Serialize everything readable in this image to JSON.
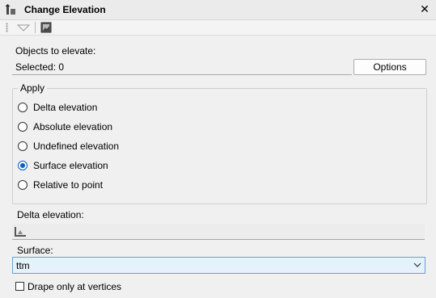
{
  "window": {
    "title": "Change Elevation",
    "close_icon": "close-icon"
  },
  "objects": {
    "label": "Objects to elevate:",
    "selected": "Selected: 0",
    "options_label": "Options"
  },
  "apply": {
    "title": "Apply",
    "options": [
      {
        "label": "Delta elevation",
        "checked": false
      },
      {
        "label": "Absolute elevation",
        "checked": false
      },
      {
        "label": "Undefined elevation",
        "checked": false
      },
      {
        "label": "Surface elevation",
        "checked": true
      },
      {
        "label": "Relative to point",
        "checked": false
      }
    ]
  },
  "delta": {
    "label": "Delta elevation:",
    "value": ""
  },
  "surface": {
    "label": "Surface:",
    "value": "ttm"
  },
  "drape": {
    "label": "Drape only at vertices",
    "checked": false
  },
  "colors": {
    "accent": "#0a5fbf",
    "select_bg": "#e5f1fb",
    "select_border": "#6aa0d8"
  }
}
